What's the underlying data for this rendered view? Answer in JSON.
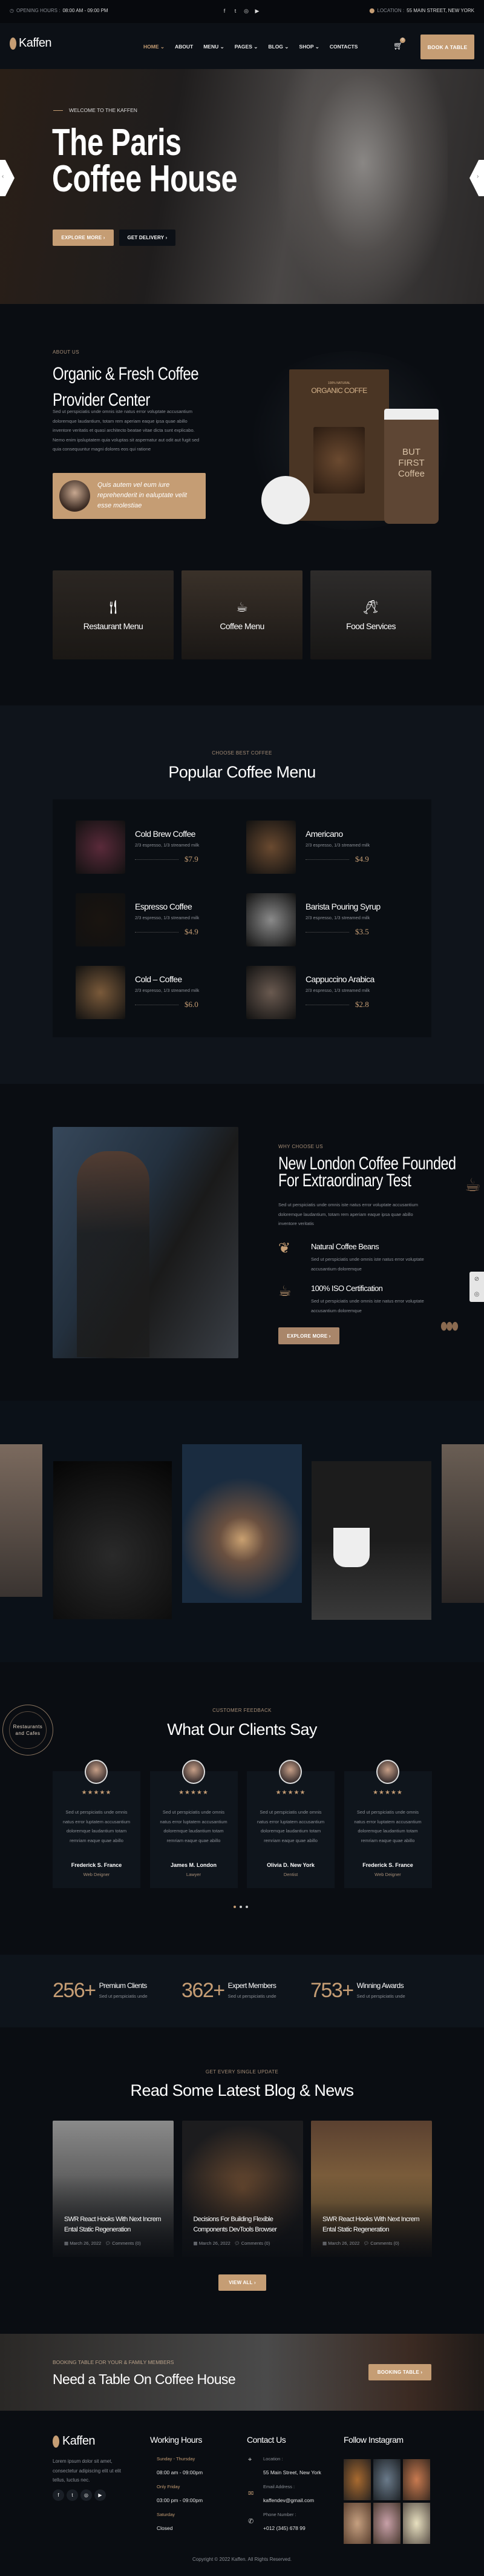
{
  "topbar": {
    "hours_label": "OPENING HOURS :",
    "hours_value": "08:00 AM - 09:00 PM",
    "location_label": "LOCATION :",
    "location_value": "55 MAIN STREET, NEW YORK"
  },
  "brand": {
    "name": "Kaffen",
    "accent": "#c59d74"
  },
  "nav": {
    "items": [
      {
        "label": "HOME"
      },
      {
        "label": "ABOUT"
      },
      {
        "label": "MENU"
      },
      {
        "label": "PAGES"
      },
      {
        "label": "BLOG"
      },
      {
        "label": "SHOP"
      },
      {
        "label": "CONTACTS"
      }
    ],
    "cart_count": "0",
    "book_label": "BOOK A TABLE"
  },
  "hero": {
    "eyebrow": "WELCOME TO THE KAFFEN",
    "title_line1": "The Paris",
    "title_line2": "Coffee House",
    "explore": "EXPLORE MORE",
    "delivery": "GET DELIVERY"
  },
  "about": {
    "eyebrow": "ABOUT US",
    "title_line1": "Organic & Fresh Coffee",
    "title_line2": "Provider Center",
    "text": "Sed ut perspiciatis unde omnis iste natus error voluptate accusantium doloremque laudantium, totam rem aperiam eaque ipsa quae abillo inventore veritatis et quasi architecto beatae vitae dicta sunt explicabo. Nemo enim ipsluptatem quia voluptas sit aspernatur aut odit aut fugit sed quia consequuntur magni dolores eos qui ratione",
    "quote": "Quis autem vel eum iure reprehenderit in ealuptate velit esse molestiae",
    "pack_label": "ORGANIC COFFE",
    "pack_small": "100% NATURAL",
    "cup_text": "BUT FIRST Coffee"
  },
  "services": [
    {
      "label": "Restaurant Menu"
    },
    {
      "label": "Coffee Menu"
    },
    {
      "label": "Food Services"
    }
  ],
  "menu": {
    "eyebrow": "CHOOSE BEST COFFEE",
    "title": "Popular Coffee Menu",
    "items": [
      {
        "name": "Cold Brew Coffee",
        "desc": "2/3 espresso, 1/3 streamed milk",
        "price": "$7.9"
      },
      {
        "name": "Americano",
        "desc": "2/3 espresso, 1/3 streamed milk",
        "price": "$4.9"
      },
      {
        "name": "Espresso Coffee",
        "desc": "2/3 espresso, 1/3 streamed milk",
        "price": "$4.9"
      },
      {
        "name": "Barista Pouring Syrup",
        "desc": "2/3 espresso, 1/3 streamed milk",
        "price": "$3.5"
      },
      {
        "name": "Cold – Coffee",
        "desc": "2/3 espresso, 1/3 streamed milk",
        "price": "$6.0"
      },
      {
        "name": "Cappuccino Arabica",
        "desc": "2/3 espresso, 1/3 streamed milk",
        "price": "$2.8"
      }
    ]
  },
  "why": {
    "eyebrow": "WHY CHOOSE US",
    "title_line1": "New London Coffee Founded",
    "title_line2": "For Extraordinary Test",
    "text": "Sed ut perspiciatis unde omnis iste natus error voluptate accusantium doloremque laudantium, totam rem aperiam eaque ipsa quae abillo inventore veritatis",
    "features": [
      {
        "title": "Natural Coffee Beans",
        "text": "Sed ut perspiciatis unde omnis iste natus error voluptate accusantium doloremque"
      },
      {
        "title": "100% ISO Certification",
        "text": "Sed ut perspiciatis unde omnis iste natus error voluptate accusantium doloremque"
      }
    ],
    "button": "EXPLORE MORE"
  },
  "testimonials": {
    "eyebrow": "CUSTOMER FEEDBACK",
    "title": "What Our Clients Say",
    "stamp": "Restaurants and Cafes",
    "items": [
      {
        "text": "Sed ut perspiciatis unde omnis natus error luptatem accusantium doloremque laudantium totam remriam eaque quae abillo",
        "name": "Frederick S. France",
        "role": "Web Deigner",
        "rating": 5
      },
      {
        "text": "Sed ut perspiciatis unde omnis natus error luptatem accusantium doloremque laudantium totam remriam eaque quae abillo",
        "name": "James M. London",
        "role": "Lawyer",
        "rating": 5
      },
      {
        "text": "Sed ut perspiciatis unde omnis natus error luptatem accusantium doloremque laudantium totam remriam eaque quae abillo",
        "name": "Olivia D. New York",
        "role": "Dentist",
        "rating": 5
      },
      {
        "text": "Sed ut perspiciatis unde omnis natus error luptatem accusantium doloremque laudantium totam remriam eaque quae abillo",
        "name": "Frederick S. France",
        "role": "Web Deigner",
        "rating": 5
      }
    ]
  },
  "stats": [
    {
      "num": "256+",
      "title": "Premium Clients",
      "text": "Sed ut perspiciatis unde"
    },
    {
      "num": "362+",
      "title": "Expert Members",
      "text": "Sed ut perspiciatis unde"
    },
    {
      "num": "753+",
      "title": "Winning Awards",
      "text": "Sed ut perspiciatis unde"
    }
  ],
  "blog": {
    "eyebrow": "GET EVERY SINGLE UPDATE",
    "title": "Read Some Latest Blog & News",
    "posts": [
      {
        "title": "SWR React Hooks With Next Increm Ental Static Regeneration",
        "date": "March 26, 2022",
        "comments": "Comments (0)"
      },
      {
        "title": "Decisions For Building Flexible Components DevTools Browser",
        "date": "March 26, 2022",
        "comments": "Comments (0)"
      },
      {
        "title": "SWR React Hooks With Next Increm Ental Static Regeneration",
        "date": "March 26, 2022",
        "comments": "Comments (0)"
      }
    ],
    "view_all": "VIEW ALL"
  },
  "booking": {
    "eyebrow": "BOOKING TABLE FOR YOUR & FAMILY MEMBERS",
    "title": "Need a Table On Coffee House",
    "button": "BOOKING TABLE"
  },
  "footer": {
    "about": "Lorem ipsum dolor sit amet, consectetur adipiscing elit ut elit tellus, luctus nec.",
    "hours_title": "Working Hours",
    "hours": [
      {
        "day": "Sunday - Thursday",
        "time": "08:00 am - 09:00pm"
      },
      {
        "day": "Only Friday",
        "time": "03:00 pm - 09:00pm"
      },
      {
        "day": "Saturday",
        "time": "Closed"
      }
    ],
    "contact_title": "Contact Us",
    "contacts": [
      {
        "label": "Location :",
        "value": "55 Main Street, New York"
      },
      {
        "label": "Email Address :",
        "value": "kaffendev@gmail.com"
      },
      {
        "label": "Phone Number :",
        "value": "+012 (345) 678 99"
      }
    ],
    "instagram_title": "Follow Instagram",
    "copyright": "Copyright © 2022 Kaffen. All Rights Reserved."
  }
}
